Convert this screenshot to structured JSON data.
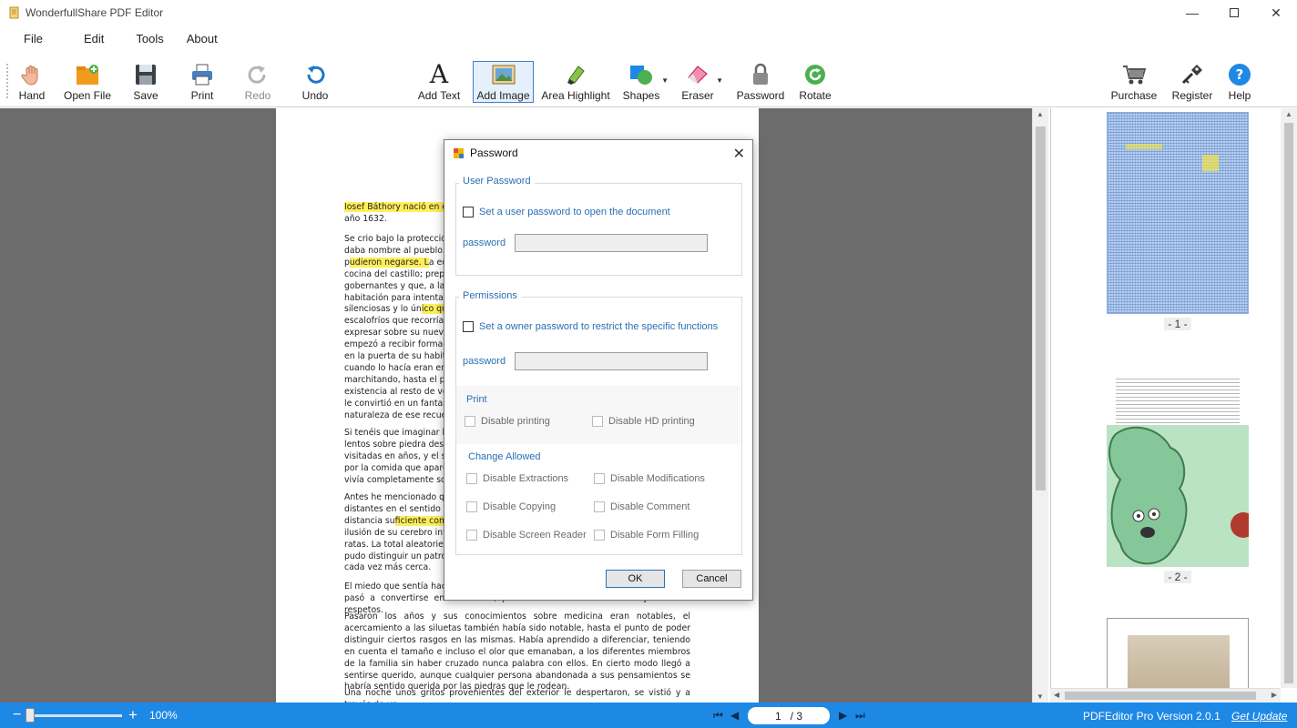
{
  "window": {
    "title": "WonderfullShare PDF Editor"
  },
  "menu": [
    "File",
    "Edit",
    "Tools",
    "About"
  ],
  "toolbar": {
    "hand": "Hand",
    "open_file": "Open File",
    "save": "Save",
    "print": "Print",
    "redo": "Redo",
    "undo": "Undo",
    "add_text": "Add Text",
    "add_image": "Add Image",
    "area_highlight": "Area Highlight",
    "shapes": "Shapes",
    "eraser": "Eraser",
    "password": "Password",
    "rotate": "Rotate",
    "purchase": "Purchase",
    "register": "Register",
    "help": "Help"
  },
  "document": {
    "paragraphs": [
      {
        "pre": "",
        "hl": "Iosef Báthory nació en el pu",
        "post": "\naño 1632."
      },
      {
        "pre": "Se crio bajo la protección c\ndaba nombre al pueblo. Al\np",
        "hl": "udieron negarse. L",
        "post": "a educ\ncocina del castillo; preparab\ngobernantes y que, a la ma\nhabitación para intentar es\nsilenciosas y lo ún"
      },
      {
        "hl2": "ico que co",
        "post2": "\nescalofríos que recorrían s\nexpresar sobre su nueva fa\nempezó a recibir formación\nen la puerta de su habitació\ncuando lo hacía eran encue\nmarchitando, hasta el punt\nexistencia al resto de vecino\nle convirtió en un fantasma,\nnaturaleza de ese recuerdo."
      },
      {
        "text": "Si tenéis que imaginar la vid\nlentos sobre piedra desnud\nvisitadas en años, y el susur\npor la comida que aparecía\nvivía completamente solo e"
      },
      {
        "pre": "Antes he mencionado que \ndistantes en el sentido más\ndistancia su",
        "hl": "ficiente como p",
        "post": "\nilusión de su cerebro intent\nratas. La total aleatoriedad d\npudo distinguir un patrón, y\ncada vez más cerca."
      },
      {
        "text": "El miedo que sentía hacia l\npasó a convertirse en curiosidad, para finalmente infundir el mayor de los respetos."
      },
      {
        "text": "Pasaron los años y sus conocimientos sobre medicina eran notables, el acercamiento a las siluetas también había sido notable, hasta el punto de poder distinguir ciertos rasgos en las mismas. Había aprendido a diferenciar, teniendo en cuenta el tamaño e incluso el olor que emanaban, a los diferentes miembros de la familia sin haber cruzado nunca palabra con ellos. En cierto modo llegó a sentirse querido, aunque cualquier persona abandonada a sus pensamientos se habría sentido querida por las piedras que le rodean."
      },
      {
        "text": "Una noche unos gritos provenientes del exterior le despertaron, se vistió y a través de un"
      }
    ]
  },
  "thumbnails": {
    "labels": [
      "- 1 -",
      "- 2 -"
    ]
  },
  "dialog": {
    "title": "Password",
    "user_password": {
      "legend": "User Password",
      "checkbox": "Set a user password to open the document",
      "field_label": "password",
      "value": ""
    },
    "permissions": {
      "legend": "Permissions",
      "checkbox": "Set a owner password to restrict the specific functions",
      "field_label": "password",
      "value": "",
      "print_title": "Print",
      "disable_printing": "Disable printing",
      "disable_hd_printing": "Disable HD printing",
      "change_title": "Change Allowed",
      "disable_extractions": "Disable Extractions",
      "disable_modifications": "Disable Modifications",
      "disable_copying": "Disable Copying",
      "disable_comment": "Disable Comment",
      "disable_screen_reader": "Disable Screen Reader",
      "disable_form_filling": "Disable Form Filling"
    },
    "ok": "OK",
    "cancel": "Cancel"
  },
  "status": {
    "zoom": "100%",
    "page_current": "1",
    "page_total": "/ 3",
    "version": "PDFEditor Pro Version 2.0.1",
    "get_update": "Get Update"
  },
  "colors": {
    "statusbar": "#1e88e5",
    "accent": "#2a6fb5",
    "highlight": "#ffef5a"
  }
}
